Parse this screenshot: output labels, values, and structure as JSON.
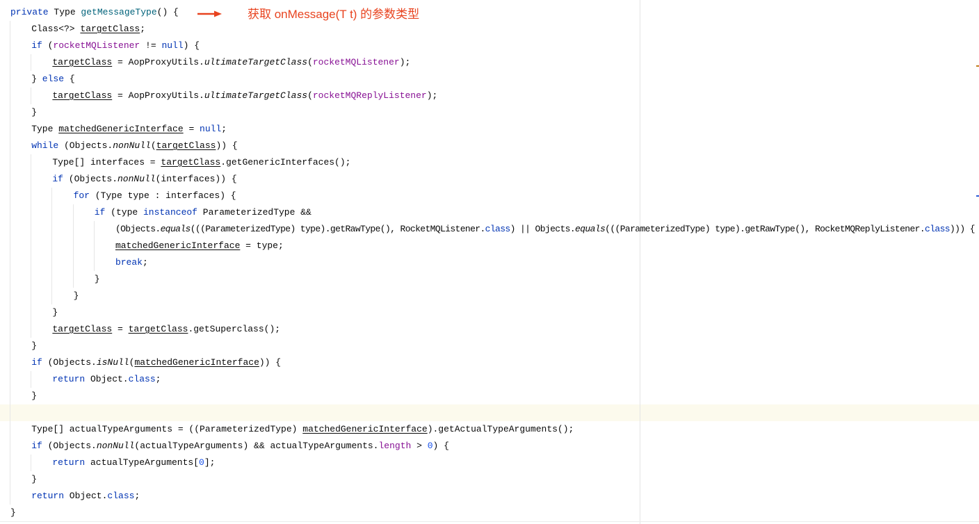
{
  "annotation": {
    "text": "获取 onMessage(T t) 的参数类型",
    "color": "#e8431f",
    "arrow_icon": "arrow-right"
  },
  "colors": {
    "keyword": "#0033b3",
    "method_decl": "#00627a",
    "field": "#871094",
    "number": "#1750eb",
    "current_line": "#fcfaed",
    "warning_mark": "#c27d1a",
    "info_mark": "#2a5bd7"
  },
  "code": {
    "current_line": 25,
    "lines": [
      {
        "indent": 0,
        "tokens": [
          [
            "private",
            "k"
          ],
          [
            " Type ",
            ""
          ],
          [
            "getMessageType",
            "f"
          ],
          [
            "() {",
            ""
          ]
        ]
      },
      {
        "indent": 1,
        "tokens": [
          [
            "Class<?> ",
            ""
          ],
          [
            "targetClass",
            "u"
          ],
          [
            ";",
            ""
          ]
        ]
      },
      {
        "indent": 1,
        "tokens": [
          [
            "if",
            "k"
          ],
          [
            " (",
            ""
          ],
          [
            "rocketMQListener",
            "p"
          ],
          [
            " != ",
            ""
          ],
          [
            "null",
            "k"
          ],
          [
            ") {",
            ""
          ]
        ]
      },
      {
        "indent": 2,
        "tokens": [
          [
            "targetClass",
            "u"
          ],
          [
            " = AopProxyUtils.",
            ""
          ],
          [
            "ultimateTargetClass",
            "i"
          ],
          [
            "(",
            ""
          ],
          [
            "rocketMQListener",
            "p"
          ],
          [
            ");",
            ""
          ]
        ]
      },
      {
        "indent": 1,
        "tokens": [
          [
            "} ",
            ""
          ],
          [
            "else",
            "k"
          ],
          [
            " {",
            ""
          ]
        ]
      },
      {
        "indent": 2,
        "tokens": [
          [
            "targetClass",
            "u"
          ],
          [
            " = AopProxyUtils.",
            ""
          ],
          [
            "ultimateTargetClass",
            "i"
          ],
          [
            "(",
            ""
          ],
          [
            "rocketMQReplyListener",
            "p"
          ],
          [
            ");",
            ""
          ]
        ]
      },
      {
        "indent": 1,
        "tokens": [
          [
            "}",
            ""
          ]
        ]
      },
      {
        "indent": 1,
        "tokens": [
          [
            "Type ",
            ""
          ],
          [
            "matchedGenericInterface",
            "u"
          ],
          [
            " = ",
            ""
          ],
          [
            "null",
            "k"
          ],
          [
            ";",
            ""
          ]
        ]
      },
      {
        "indent": 1,
        "tokens": [
          [
            "while",
            "k"
          ],
          [
            " (Objects.",
            ""
          ],
          [
            "nonNull",
            "i"
          ],
          [
            "(",
            ""
          ],
          [
            "targetClass",
            "u"
          ],
          [
            ")) {",
            ""
          ]
        ]
      },
      {
        "indent": 2,
        "tokens": [
          [
            "Type[] interfaces = ",
            ""
          ],
          [
            "targetClass",
            "u"
          ],
          [
            ".getGenericInterfaces();",
            ""
          ]
        ]
      },
      {
        "indent": 2,
        "tokens": [
          [
            "if",
            "k"
          ],
          [
            " (Objects.",
            ""
          ],
          [
            "nonNull",
            "i"
          ],
          [
            "(interfaces)) {",
            ""
          ]
        ]
      },
      {
        "indent": 3,
        "tokens": [
          [
            "for",
            "k"
          ],
          [
            " (Type type : interfaces) {",
            ""
          ]
        ]
      },
      {
        "indent": 4,
        "tokens": [
          [
            "if",
            "k"
          ],
          [
            " (type ",
            ""
          ],
          [
            "instanceof",
            "k"
          ],
          [
            " ParameterizedType &&",
            ""
          ]
        ]
      },
      {
        "indent": 5,
        "tokens": [
          [
            "(Objects.",
            ""
          ],
          [
            "equals",
            "i"
          ],
          [
            "(((ParameterizedType) type).getRawType(), RocketMQListener.",
            ""
          ],
          [
            "class",
            "k"
          ],
          [
            ") || Objects.",
            ""
          ],
          [
            "equals",
            "i"
          ],
          [
            "(((ParameterizedType) type).getRawType(), RocketMQReplyListener.",
            ""
          ],
          [
            "class",
            "k"
          ],
          [
            "))) {",
            ""
          ]
        ]
      },
      {
        "indent": 5,
        "tokens": [
          [
            "matchedGenericInterface",
            "u"
          ],
          [
            " = type;",
            ""
          ]
        ]
      },
      {
        "indent": 5,
        "tokens": [
          [
            "break",
            "k"
          ],
          [
            ";",
            ""
          ]
        ]
      },
      {
        "indent": 4,
        "tokens": [
          [
            "}",
            ""
          ]
        ]
      },
      {
        "indent": 3,
        "tokens": [
          [
            "}",
            ""
          ]
        ]
      },
      {
        "indent": 2,
        "tokens": [
          [
            "}",
            ""
          ]
        ]
      },
      {
        "indent": 2,
        "tokens": [
          [
            "targetClass",
            "u"
          ],
          [
            " = ",
            ""
          ],
          [
            "targetClass",
            "u"
          ],
          [
            ".getSuperclass();",
            ""
          ]
        ]
      },
      {
        "indent": 1,
        "tokens": [
          [
            "}",
            ""
          ]
        ]
      },
      {
        "indent": 1,
        "tokens": [
          [
            "if",
            "k"
          ],
          [
            " (Objects.",
            ""
          ],
          [
            "isNull",
            "i"
          ],
          [
            "(",
            ""
          ],
          [
            "matchedGenericInterface",
            "u"
          ],
          [
            ")) {",
            ""
          ]
        ]
      },
      {
        "indent": 2,
        "tokens": [
          [
            "return",
            "k"
          ],
          [
            " Object.",
            ""
          ],
          [
            "class",
            "k"
          ],
          [
            ";",
            ""
          ]
        ]
      },
      {
        "indent": 1,
        "tokens": [
          [
            "}",
            ""
          ]
        ]
      },
      {
        "indent": 1,
        "tokens": []
      },
      {
        "indent": 1,
        "tokens": [
          [
            "Type[] actualTypeArguments = ((ParameterizedType) ",
            ""
          ],
          [
            "matchedGenericInterface",
            "u"
          ],
          [
            ").getActualTypeArguments();",
            ""
          ]
        ]
      },
      {
        "indent": 1,
        "tokens": [
          [
            "if",
            "k"
          ],
          [
            " (Objects.",
            ""
          ],
          [
            "nonNull",
            "i"
          ],
          [
            "(actualTypeArguments) && actualTypeArguments.",
            ""
          ],
          [
            "length",
            "p"
          ],
          [
            " > ",
            ""
          ],
          [
            "0",
            "n"
          ],
          [
            ") {",
            ""
          ]
        ]
      },
      {
        "indent": 2,
        "tokens": [
          [
            "return",
            "k"
          ],
          [
            " actualTypeArguments[",
            ""
          ],
          [
            "0",
            "n"
          ],
          [
            "];",
            ""
          ]
        ]
      },
      {
        "indent": 1,
        "tokens": [
          [
            "}",
            ""
          ]
        ]
      },
      {
        "indent": 1,
        "tokens": [
          [
            "return",
            "k"
          ],
          [
            " Object.",
            ""
          ],
          [
            "class",
            "k"
          ],
          [
            ";",
            ""
          ]
        ]
      },
      {
        "indent": 0,
        "tokens": [
          [
            "}",
            ""
          ]
        ]
      }
    ]
  }
}
